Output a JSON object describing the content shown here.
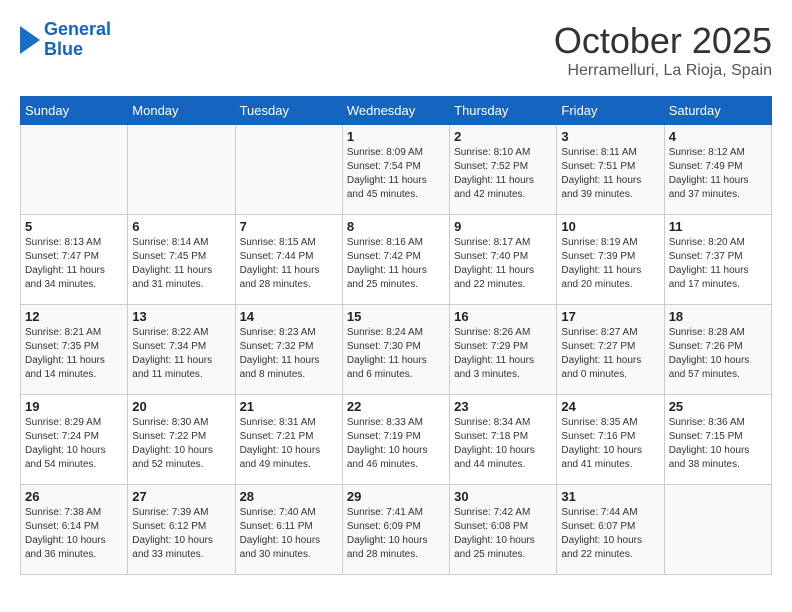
{
  "header": {
    "logo_line1": "General",
    "logo_line2": "Blue",
    "month": "October 2025",
    "location": "Herramelluri, La Rioja, Spain"
  },
  "weekdays": [
    "Sunday",
    "Monday",
    "Tuesday",
    "Wednesday",
    "Thursday",
    "Friday",
    "Saturday"
  ],
  "weeks": [
    [
      {
        "day": "",
        "info": ""
      },
      {
        "day": "",
        "info": ""
      },
      {
        "day": "",
        "info": ""
      },
      {
        "day": "1",
        "info": "Sunrise: 8:09 AM\nSunset: 7:54 PM\nDaylight: 11 hours and 45 minutes."
      },
      {
        "day": "2",
        "info": "Sunrise: 8:10 AM\nSunset: 7:52 PM\nDaylight: 11 hours and 42 minutes."
      },
      {
        "day": "3",
        "info": "Sunrise: 8:11 AM\nSunset: 7:51 PM\nDaylight: 11 hours and 39 minutes."
      },
      {
        "day": "4",
        "info": "Sunrise: 8:12 AM\nSunset: 7:49 PM\nDaylight: 11 hours and 37 minutes."
      }
    ],
    [
      {
        "day": "5",
        "info": "Sunrise: 8:13 AM\nSunset: 7:47 PM\nDaylight: 11 hours and 34 minutes."
      },
      {
        "day": "6",
        "info": "Sunrise: 8:14 AM\nSunset: 7:45 PM\nDaylight: 11 hours and 31 minutes."
      },
      {
        "day": "7",
        "info": "Sunrise: 8:15 AM\nSunset: 7:44 PM\nDaylight: 11 hours and 28 minutes."
      },
      {
        "day": "8",
        "info": "Sunrise: 8:16 AM\nSunset: 7:42 PM\nDaylight: 11 hours and 25 minutes."
      },
      {
        "day": "9",
        "info": "Sunrise: 8:17 AM\nSunset: 7:40 PM\nDaylight: 11 hours and 22 minutes."
      },
      {
        "day": "10",
        "info": "Sunrise: 8:19 AM\nSunset: 7:39 PM\nDaylight: 11 hours and 20 minutes."
      },
      {
        "day": "11",
        "info": "Sunrise: 8:20 AM\nSunset: 7:37 PM\nDaylight: 11 hours and 17 minutes."
      }
    ],
    [
      {
        "day": "12",
        "info": "Sunrise: 8:21 AM\nSunset: 7:35 PM\nDaylight: 11 hours and 14 minutes."
      },
      {
        "day": "13",
        "info": "Sunrise: 8:22 AM\nSunset: 7:34 PM\nDaylight: 11 hours and 11 minutes."
      },
      {
        "day": "14",
        "info": "Sunrise: 8:23 AM\nSunset: 7:32 PM\nDaylight: 11 hours and 8 minutes."
      },
      {
        "day": "15",
        "info": "Sunrise: 8:24 AM\nSunset: 7:30 PM\nDaylight: 11 hours and 6 minutes."
      },
      {
        "day": "16",
        "info": "Sunrise: 8:26 AM\nSunset: 7:29 PM\nDaylight: 11 hours and 3 minutes."
      },
      {
        "day": "17",
        "info": "Sunrise: 8:27 AM\nSunset: 7:27 PM\nDaylight: 11 hours and 0 minutes."
      },
      {
        "day": "18",
        "info": "Sunrise: 8:28 AM\nSunset: 7:26 PM\nDaylight: 10 hours and 57 minutes."
      }
    ],
    [
      {
        "day": "19",
        "info": "Sunrise: 8:29 AM\nSunset: 7:24 PM\nDaylight: 10 hours and 54 minutes."
      },
      {
        "day": "20",
        "info": "Sunrise: 8:30 AM\nSunset: 7:22 PM\nDaylight: 10 hours and 52 minutes."
      },
      {
        "day": "21",
        "info": "Sunrise: 8:31 AM\nSunset: 7:21 PM\nDaylight: 10 hours and 49 minutes."
      },
      {
        "day": "22",
        "info": "Sunrise: 8:33 AM\nSunset: 7:19 PM\nDaylight: 10 hours and 46 minutes."
      },
      {
        "day": "23",
        "info": "Sunrise: 8:34 AM\nSunset: 7:18 PM\nDaylight: 10 hours and 44 minutes."
      },
      {
        "day": "24",
        "info": "Sunrise: 8:35 AM\nSunset: 7:16 PM\nDaylight: 10 hours and 41 minutes."
      },
      {
        "day": "25",
        "info": "Sunrise: 8:36 AM\nSunset: 7:15 PM\nDaylight: 10 hours and 38 minutes."
      }
    ],
    [
      {
        "day": "26",
        "info": "Sunrise: 7:38 AM\nSunset: 6:14 PM\nDaylight: 10 hours and 36 minutes."
      },
      {
        "day": "27",
        "info": "Sunrise: 7:39 AM\nSunset: 6:12 PM\nDaylight: 10 hours and 33 minutes."
      },
      {
        "day": "28",
        "info": "Sunrise: 7:40 AM\nSunset: 6:11 PM\nDaylight: 10 hours and 30 minutes."
      },
      {
        "day": "29",
        "info": "Sunrise: 7:41 AM\nSunset: 6:09 PM\nDaylight: 10 hours and 28 minutes."
      },
      {
        "day": "30",
        "info": "Sunrise: 7:42 AM\nSunset: 6:08 PM\nDaylight: 10 hours and 25 minutes."
      },
      {
        "day": "31",
        "info": "Sunrise: 7:44 AM\nSunset: 6:07 PM\nDaylight: 10 hours and 22 minutes."
      },
      {
        "day": "",
        "info": ""
      }
    ]
  ]
}
